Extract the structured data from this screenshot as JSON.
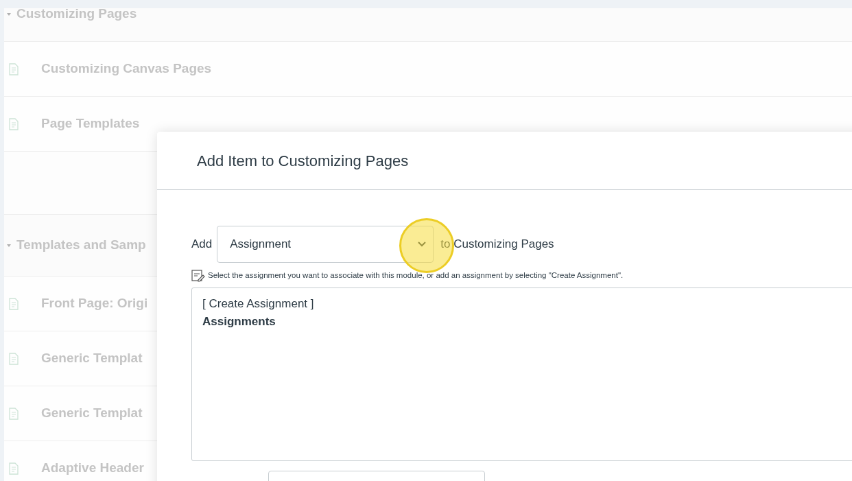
{
  "modules": [
    {
      "title": "Customizing Pages",
      "items": [
        {
          "title": "Customizing Canvas Pages"
        },
        {
          "title": "Page Templates"
        }
      ]
    },
    {
      "title": "Templates and Samp",
      "items": [
        {
          "title": "Front Page: Origi"
        },
        {
          "title": "Generic Templat"
        },
        {
          "title": "Generic Templat"
        },
        {
          "title": "Adaptive Header"
        }
      ]
    }
  ],
  "dialog": {
    "title": "Add Item to Customizing Pages",
    "add_label": "Add",
    "type_select": {
      "value": "Assignment"
    },
    "to_label": "to Customizing Pages",
    "hint": "Select the assignment you want to associate with this module, or add an assignment by selecting \"Create Assignment\".",
    "options": [
      {
        "label": "[ Create Assignment ]",
        "kind": "option"
      },
      {
        "label": "Assignments",
        "kind": "group"
      }
    ]
  }
}
